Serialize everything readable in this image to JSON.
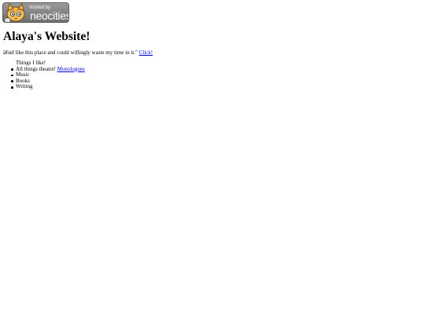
{
  "badge": {
    "small_text": "hosted by",
    "big_text": "neocities",
    "icon": "neocities-cat-icon"
  },
  "page": {
    "title": "Alaya's Website!",
    "quote_text": "â€œI like this place and could willingly waste my time in it.\" ",
    "quote_link": "Click!",
    "list_heading": "Things I like!",
    "items": [
      {
        "text": "All things theatre! ",
        "link": "Monologues"
      },
      {
        "text": "Music"
      },
      {
        "text": "Books"
      },
      {
        "text": "Writing"
      }
    ]
  },
  "colors": {
    "link": "#0000ee",
    "badge_bg": "#8a8a8a"
  }
}
